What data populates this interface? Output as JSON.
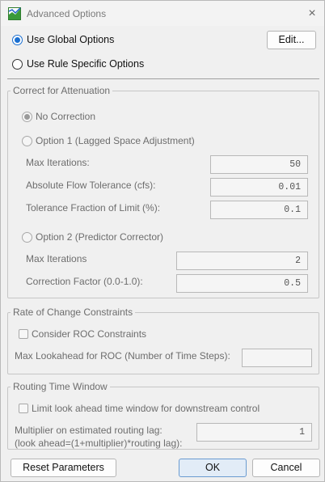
{
  "window": {
    "title": "Advanced Options",
    "close_glyph": "×",
    "icon": "app-chart-icon"
  },
  "mode": {
    "global_label": "Use Global Options",
    "global_selected": true,
    "rule_label": "Use Rule Specific Options",
    "rule_selected": false,
    "edit_label": "Edit..."
  },
  "attenuation": {
    "legend": "Correct for Attenuation",
    "no_correction_label": "No Correction",
    "option1_label": "Option 1 (Lagged Space Adjustment)",
    "option1": {
      "max_iterations_label": "Max Iterations:",
      "max_iterations_value": "50",
      "abs_flow_tol_label": "Absolute Flow Tolerance (cfs):",
      "abs_flow_tol_value": "0.01",
      "tol_fraction_label": "Tolerance Fraction of Limit (%):",
      "tol_fraction_value": "0.1"
    },
    "option2_label": "Option 2 (Predictor Corrector)",
    "option2": {
      "max_iterations_label": "Max Iterations",
      "max_iterations_value": "2",
      "correction_factor_label": "Correction Factor (0.0-1.0):",
      "correction_factor_value": "0.5"
    }
  },
  "roc": {
    "legend": "Rate of Change Constraints",
    "consider_label": "Consider ROC Constraints",
    "lookahead_label": "Max Lookahead for ROC (Number of Time Steps):",
    "lookahead_value": ""
  },
  "routing": {
    "legend": "Routing Time Window",
    "limit_label": "Limit look ahead time window for downstream control",
    "multiplier_label_line1": "Multiplier on estimated routing lag:",
    "multiplier_label_line2": "(look ahead=(1+multiplier)*routing lag):",
    "multiplier_value": "1"
  },
  "footer": {
    "reset_label": "Reset Parameters",
    "ok_label": "OK",
    "cancel_label": "Cancel"
  },
  "colors": {
    "accent": "#1a6fd1",
    "disabled_text": "#6d6d6d",
    "background": "#f0f0f0"
  }
}
